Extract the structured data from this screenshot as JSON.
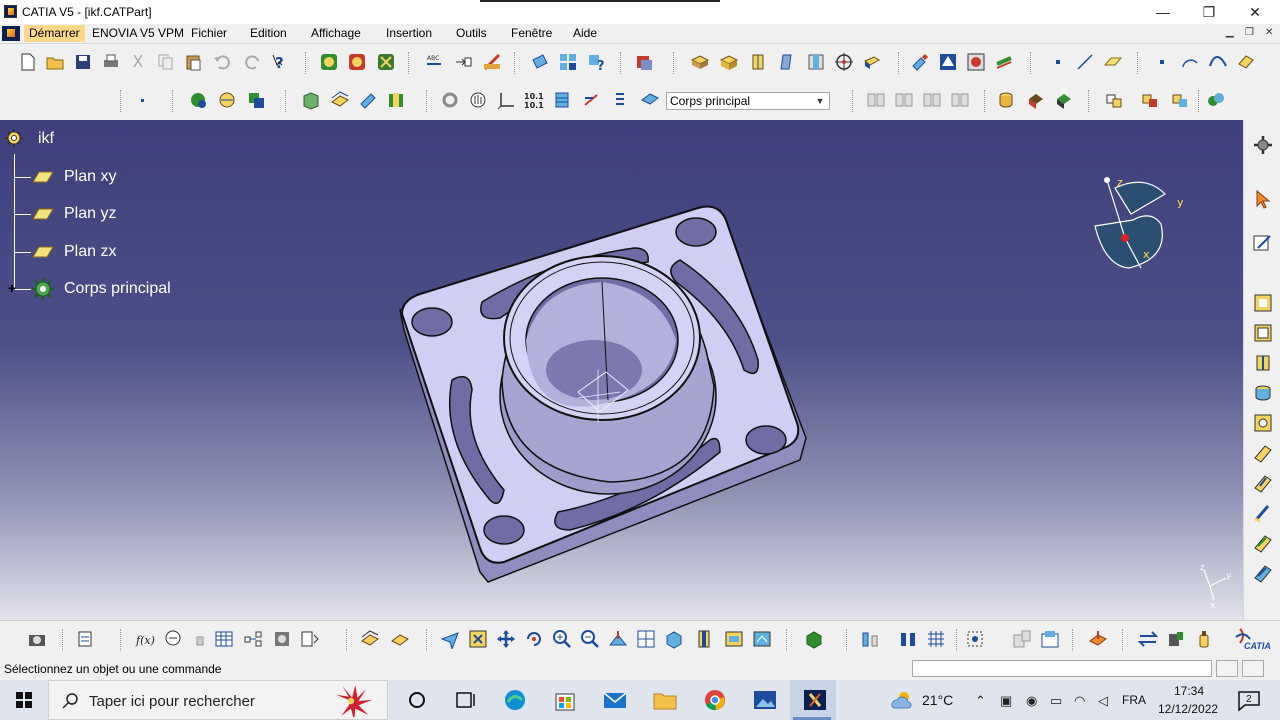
{
  "window": {
    "title": "CATIA V5 - [ikf.CATPart]",
    "minimize": "—",
    "maximize": "❐",
    "close": "✕"
  },
  "menu": {
    "items": [
      "Démarrer",
      "ENOVIA V5 VPM",
      "Fichier",
      "Edition",
      "Affichage",
      "Insertion",
      "Outils",
      "Fenêtre",
      "Aide"
    ]
  },
  "toolbar": {
    "body_selector": "Corps principal",
    "calc_icon_text": "10.1"
  },
  "tree": {
    "root": "ikf",
    "items": [
      "Plan xy",
      "Plan yz",
      "Plan zx",
      "Corps principal"
    ],
    "expand_glyph": "+"
  },
  "compass": {
    "x_label": "x",
    "y_label": "y",
    "z_label": "z"
  },
  "statusbar": {
    "message": "Sélectionnez un objet ou une commande"
  },
  "brand": {
    "logo_text": "CATIA"
  },
  "taskbar": {
    "search_placeholder": "Taper ici pour rechercher",
    "weather": "21°C",
    "language": "FRA",
    "time": "17:34",
    "date": "12/12/2022",
    "notifications_count": "2"
  },
  "colors": {
    "viewport_top": "#3e3f7c",
    "viewport_bottom": "#e2e3ec",
    "part_face": "#c9c8f0",
    "part_side": "#9e9cc9",
    "highlight": "#ffd98a"
  }
}
